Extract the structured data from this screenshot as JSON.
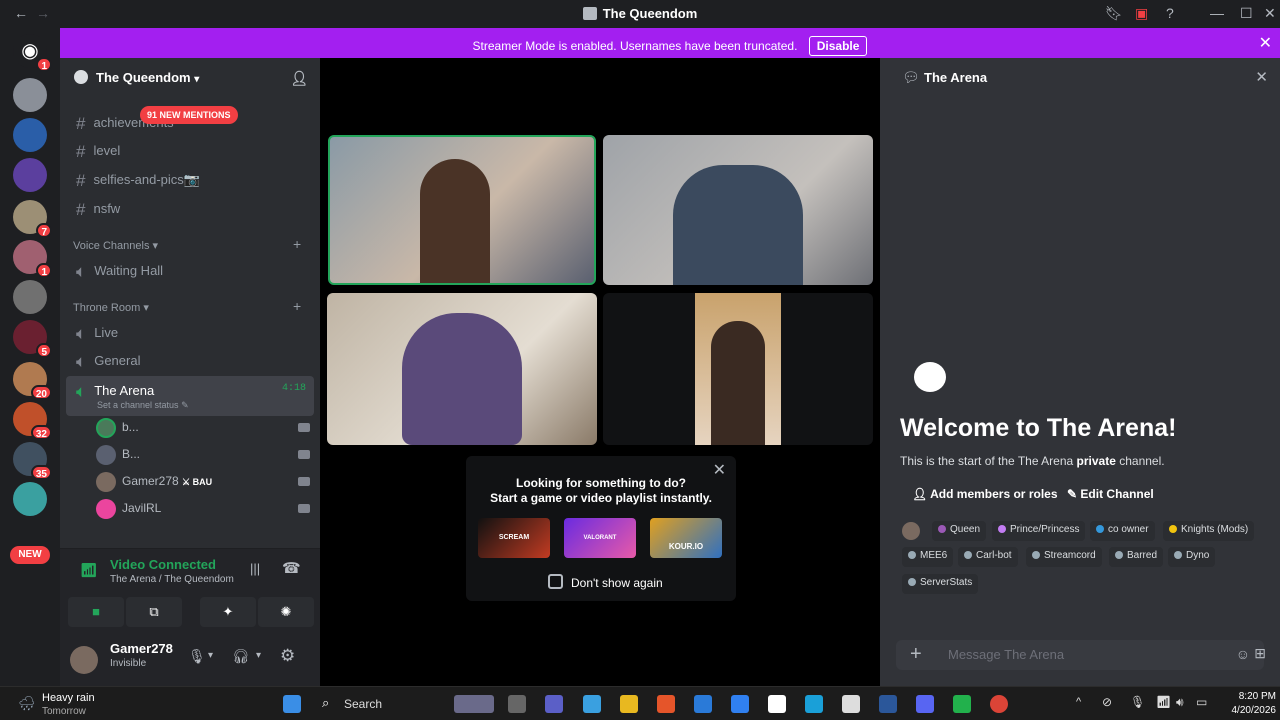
{
  "titlebar": {
    "title": "The Queendom"
  },
  "banner": {
    "text": "Streamer Mode is enabled. Usernames have been truncated.",
    "button": "Disable"
  },
  "servers": {
    "badges": [
      "1",
      "7",
      "1",
      "5",
      "20",
      "32",
      "35"
    ],
    "new_label": "NEW"
  },
  "sidebar": {
    "guild_name": "The Queendom",
    "mention_banner": "91 NEW MENTIONS",
    "text_channels": [
      "achievements",
      "level",
      "selfies-and-pics📷",
      "nsfw"
    ],
    "voice_category": "Voice Channels",
    "voice_channels": [
      "Waiting Hall"
    ],
    "throne_category": "Throne Room",
    "throne_channels": [
      "Live",
      "General"
    ],
    "active_channel": {
      "name": "The Arena",
      "time": "4:18",
      "status_placeholder": "Set a channel status"
    },
    "participants": [
      {
        "name": "b...",
        "tag": ""
      },
      {
        "name": "B...",
        "tag": ""
      },
      {
        "name": "Gamer278",
        "tag": "BAU"
      },
      {
        "name": "JavilRL",
        "tag": ""
      }
    ]
  },
  "voice": {
    "status": "Video Connected",
    "location": "The Arena / The Queendom"
  },
  "user": {
    "name": "Gamer278",
    "status": "Invisible"
  },
  "activity_popup": {
    "line1": "Looking for something to do?",
    "line2": "Start a game or video playlist instantly.",
    "games": [
      "SCREAM",
      "VALORANT",
      "KOUR.IO"
    ],
    "dont_show": "Don't show again"
  },
  "chat": {
    "header": "The Arena",
    "welcome": "Welcome to The Arena!",
    "intro_prefix": "This is the start of the The Arena ",
    "intro_bold": "private",
    "intro_suffix": " channel.",
    "add_members": "Add members or roles",
    "edit_channel": "Edit Channel",
    "roles": [
      {
        "name": "Queen",
        "color": "#9b59b6"
      },
      {
        "name": "Prince/Princess",
        "color": "#c27cf2"
      },
      {
        "name": "co owner",
        "color": "#3498db"
      },
      {
        "name": "Knights (Mods)",
        "color": "#f1c40f"
      },
      {
        "name": "MEE6",
        "color": "#99aab5"
      },
      {
        "name": "Carl-bot",
        "color": "#99aab5"
      },
      {
        "name": "Streamcord",
        "color": "#99aab5"
      },
      {
        "name": "Barred",
        "color": "#99aab5"
      },
      {
        "name": "Dyno",
        "color": "#99aab5"
      },
      {
        "name": "ServerStats",
        "color": "#99aab5"
      }
    ],
    "message_placeholder": "Message The Arena"
  },
  "taskbar": {
    "weather_title": "Heavy rain",
    "weather_sub": "Tomorrow",
    "search": "Search",
    "time": "8:20 PM",
    "date": "4/20/2026"
  }
}
